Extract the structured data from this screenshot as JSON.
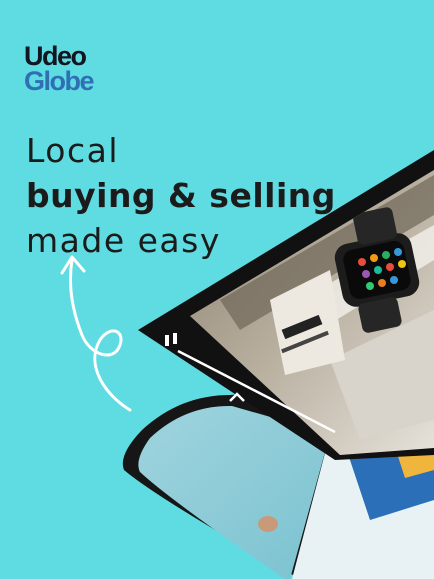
{
  "logo": {
    "line1": "Udeo",
    "line2": "Globe",
    "line2_color": "#2f6fb4"
  },
  "headline": {
    "line1": "Local",
    "line2": "buying & selling",
    "line3": "made easy"
  },
  "colors": {
    "background": "#5fdbe2",
    "device_frame": "#111111",
    "text": "#1b1b1b"
  },
  "video_player": {
    "play_state": "paused",
    "pause_icon": "pause-icon",
    "chevron_icon": "chevron-up-icon"
  },
  "product": {
    "image": "smartwatch-photo"
  }
}
